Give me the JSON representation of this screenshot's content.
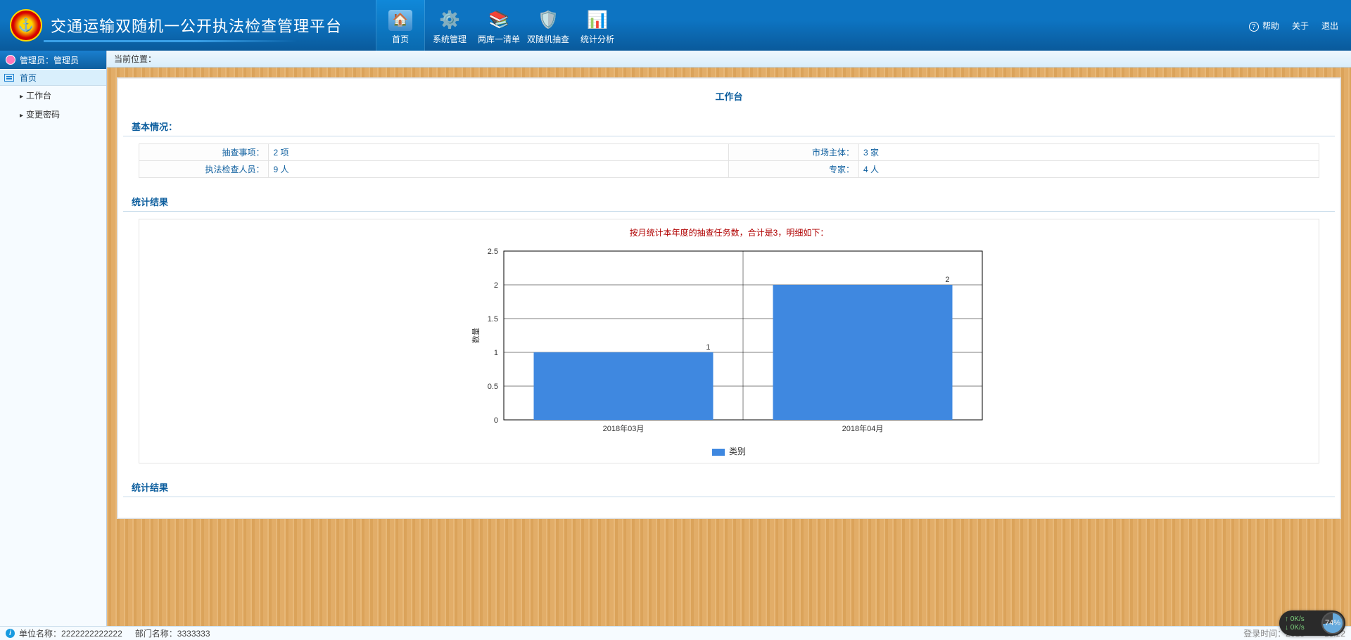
{
  "header": {
    "app_title": "交通运输双随机一公开执法检查管理平台",
    "help": "帮助",
    "about": "关于",
    "logout": "退出"
  },
  "top_nav": {
    "home": "首页",
    "system": "系统管理",
    "two_libs": "两库一清单",
    "random_check": "双随机抽查",
    "stats": "统计分析"
  },
  "sidebar": {
    "admin_label": "管理员：管理员",
    "root": "首页",
    "items": [
      "工作台",
      "变更密码"
    ]
  },
  "breadcrumb": {
    "label": "当前位置："
  },
  "workbench": {
    "title": "工作台",
    "section_basic": "基本情况：",
    "section_stats": "统计结果",
    "rows": {
      "r1l": "抽查事项：",
      "r1v": "2 项",
      "r2l": "市场主体：",
      "r2v": "3 家",
      "r3l": "执法检查人员：",
      "r3v": "9 人",
      "r4l": "专家：",
      "r4v": "4 人"
    },
    "chart_heading": "按月统计本年度的抽查任务数，合计是3，明细如下：",
    "legend": "类别",
    "ylabel": "数量"
  },
  "footer": {
    "unit_label": "单位名称：",
    "unit_value": "2222222222222",
    "dept_label": "部门名称：",
    "dept_value": "3333333",
    "login_time": "登录时间：2018-　　15:22"
  },
  "speed": {
    "up": "0K/s",
    "down": "0K/s",
    "pct": "74%"
  },
  "chart_data": {
    "type": "bar",
    "categories": [
      "2018年03月",
      "2018年04月"
    ],
    "values": [
      1,
      2
    ],
    "data_labels": [
      "1",
      "2"
    ],
    "title": "按月统计本年度的抽查任务数，合计是3，明细如下：",
    "ylabel": "数量",
    "ylim": [
      0,
      2.5
    ],
    "yticks": [
      0,
      0.5,
      1,
      1.5,
      2,
      2.5
    ],
    "legend": "类别",
    "bar_color": "#3f88e0"
  }
}
